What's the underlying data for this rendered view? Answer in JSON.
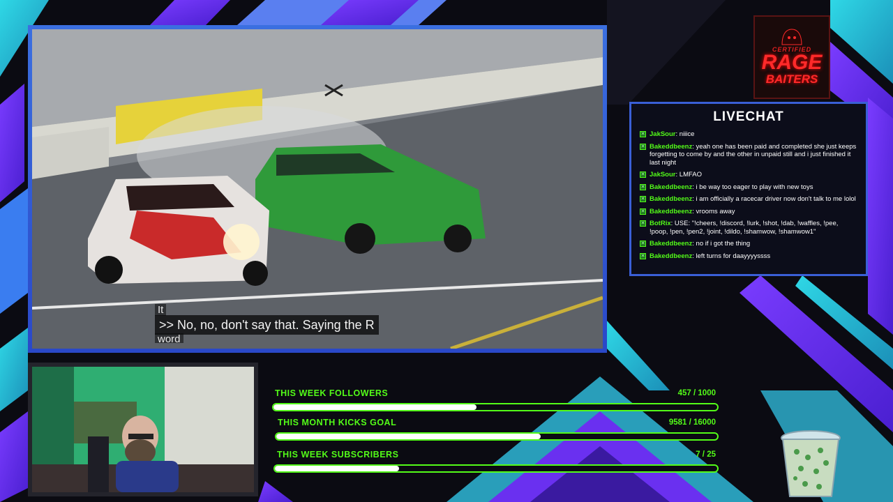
{
  "video": {
    "caption_prefix": "It",
    "caption_main": ">> No, no, don't say that. Saying the R",
    "caption_suffix": "word"
  },
  "logo": {
    "top_text": "CERTIFIED",
    "main_text": "RAGE",
    "sub_text": "BAITERS"
  },
  "livechat": {
    "title": "LIVECHAT",
    "messages": [
      {
        "user": "JakSour",
        "text": " niiice"
      },
      {
        "user": "Bakeddbeenz",
        "text": " yeah one has been paid and completed she just keeps forgetting to come by and the other in unpaid still and i just finished it last night"
      },
      {
        "user": "JakSour",
        "text": " LMFAO"
      },
      {
        "user": "Bakeddbeenz",
        "text": " i be way too eager to play with new toys"
      },
      {
        "user": "Bakeddbeenz",
        "text": " i am officially a racecar driver now don't talk to me lolol"
      },
      {
        "user": "Bakeddbeenz",
        "text": " vrooms away"
      },
      {
        "user": "BotRix",
        "text": " USE: \"!cheers, !discord, !lurk, !shot, !dab, !waffles, !pee, !poop, !pen, !pen2, !joint, !dildo, !shamwow, !shamwow1\""
      },
      {
        "user": "Bakeddbeenz",
        "text": " no if i got the thing"
      },
      {
        "user": "Bakeddbeenz",
        "text": " left turns for daayyyyssss"
      }
    ]
  },
  "goals": [
    {
      "label": "THIS WEEK FOLLOWERS",
      "count": "457 / 1000",
      "progress": 0.457
    },
    {
      "label": "THIS MONTH KICKS GOAL",
      "count": "9581 / 16000",
      "progress": 0.599
    },
    {
      "label": "THIS WEEK SUBSCRIBERS",
      "count": "7 / 25",
      "progress": 0.28
    }
  ],
  "colors": {
    "accent_green": "#53fc18",
    "frame_blue": "#3a5fd6",
    "logo_red": "#ff2a2a"
  }
}
